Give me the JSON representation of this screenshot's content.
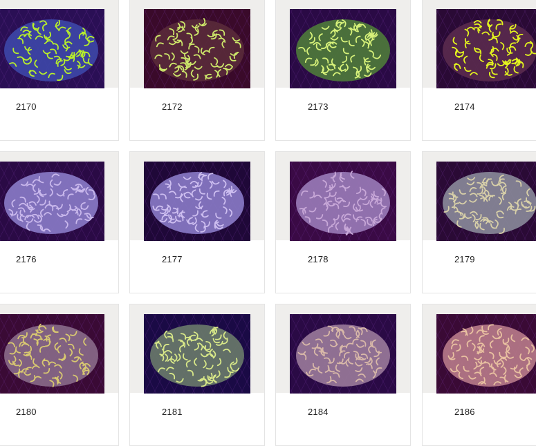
{
  "products": [
    {
      "sku": "2170",
      "image": "hammer-coral-photo",
      "palette": {
        "bg": "#2a0f55",
        "body": "#3d47a8",
        "tip": "#b8f02a"
      }
    },
    {
      "sku": "2172",
      "image": "hammer-coral-photo",
      "palette": {
        "bg": "#3a0a2a",
        "body": "#5a2a3a",
        "tip": "#cde86a"
      }
    },
    {
      "sku": "2173",
      "image": "hammer-coral-photo",
      "palette": {
        "bg": "#2a0a45",
        "body": "#4e7a3a",
        "tip": "#d7f27a"
      }
    },
    {
      "sku": "2174",
      "image": "hammer-coral-photo",
      "palette": {
        "bg": "#2a0a35",
        "body": "#5a2a4e",
        "tip": "#e4f51e"
      }
    },
    {
      "sku": "2176",
      "image": "hammer-coral-photo",
      "palette": {
        "bg": "#2a0a45",
        "body": "#8a7bc8",
        "tip": "#c9b8ec"
      }
    },
    {
      "sku": "2177",
      "image": "hammer-coral-photo",
      "palette": {
        "bg": "#1f0838",
        "body": "#8a7bc8",
        "tip": "#cdbef0"
      }
    },
    {
      "sku": "2178",
      "image": "hammer-coral-photo",
      "palette": {
        "bg": "#3a0a45",
        "body": "#9a7bb8",
        "tip": "#c8a8d8"
      }
    },
    {
      "sku": "2179",
      "image": "hammer-coral-photo",
      "palette": {
        "bg": "#2a0a35",
        "body": "#8a8a9a",
        "tip": "#d8d0a8"
      }
    },
    {
      "sku": "2180",
      "image": "hammer-coral-photo",
      "palette": {
        "bg": "#3a0a35",
        "body": "#8a6a8a",
        "tip": "#d8c870"
      }
    },
    {
      "sku": "2181",
      "image": "hammer-coral-photo",
      "palette": {
        "bg": "#1a0a45",
        "body": "#6a7a6a",
        "tip": "#d8e888"
      }
    },
    {
      "sku": "2184",
      "image": "hammer-coral-photo",
      "palette": {
        "bg": "#2a0a45",
        "body": "#9a7a9a",
        "tip": "#d8b8a8"
      }
    },
    {
      "sku": "2186",
      "image": "hammer-coral-photo",
      "palette": {
        "bg": "#3a0a35",
        "body": "#b87a8a",
        "tip": "#e8c0a0"
      }
    }
  ]
}
